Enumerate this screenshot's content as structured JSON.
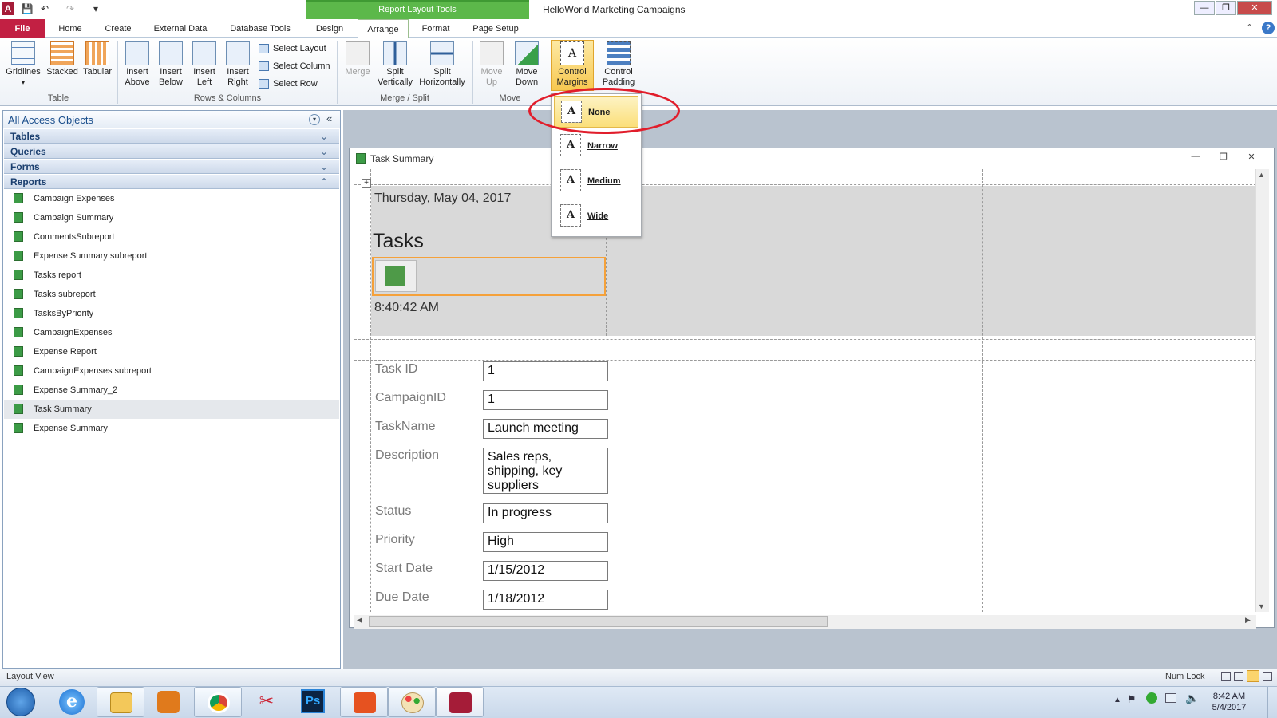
{
  "app": {
    "title": "HelloWorld Marketing Campaigns",
    "context_tab_group": "Report Layout Tools",
    "access_icon": "A"
  },
  "tabs": [
    {
      "label": "File"
    },
    {
      "label": "Home"
    },
    {
      "label": "Create"
    },
    {
      "label": "External Data"
    },
    {
      "label": "Database Tools"
    },
    {
      "label": "Design"
    },
    {
      "label": "Arrange"
    },
    {
      "label": "Format"
    },
    {
      "label": "Page Setup"
    }
  ],
  "ribbon": {
    "table_group": {
      "label": "Table",
      "gridlines": "Gridlines",
      "stacked": "Stacked",
      "tabular": "Tabular"
    },
    "rows_columns_group": {
      "label": "Rows & Columns",
      "insert_above": [
        "Insert",
        "Above"
      ],
      "insert_below": [
        "Insert",
        "Below"
      ],
      "insert_left": [
        "Insert",
        "Left"
      ],
      "insert_right": [
        "Insert",
        "Right"
      ],
      "select_layout": "Select Layout",
      "select_column": "Select Column",
      "select_row": "Select Row"
    },
    "merge_split_group": {
      "label": "Merge / Split",
      "merge": "Merge",
      "split_vertically": [
        "Split",
        "Vertically"
      ],
      "split_horizontally": [
        "Split",
        "Horizontally"
      ]
    },
    "move_group": {
      "label": "Move",
      "move_up": [
        "Move",
        "Up"
      ],
      "move_down": [
        "Move",
        "Down"
      ]
    },
    "position_group": {
      "control_margins": [
        "Control",
        "Margins"
      ],
      "control_padding": [
        "Control",
        "Padding"
      ]
    }
  },
  "margins_dropdown": {
    "items": [
      "None",
      "Narrow",
      "Medium",
      "Wide"
    ],
    "selected": "None"
  },
  "nav_pane": {
    "title": "All Access Objects",
    "groups": [
      "Tables",
      "Queries",
      "Forms",
      "Reports"
    ],
    "reports": [
      "Campaign Expenses",
      "Campaign Summary",
      "CommentsSubreport",
      "Expense Summary subreport",
      "Tasks report",
      "Tasks subreport",
      "TasksByPriority",
      "CampaignExpenses",
      "Expense Report",
      "CampaignExpenses subreport",
      "Expense Summary_2",
      "Task Summary",
      "Expense Summary"
    ],
    "selected_report": "Task Summary"
  },
  "document": {
    "title": "Task Summary",
    "date": "Thursday, May 04, 2017",
    "report_title": "Tasks",
    "time": "8:40:42 AM",
    "fields": [
      {
        "label": "Task ID",
        "value": "1"
      },
      {
        "label": "CampaignID",
        "value": "1"
      },
      {
        "label": "TaskName",
        "value": "Launch meeting"
      },
      {
        "label": "Description",
        "value": "Sales reps, shipping, key suppliers"
      },
      {
        "label": "Status",
        "value": "In progress"
      },
      {
        "label": "Priority",
        "value": "High"
      },
      {
        "label": "Start Date",
        "value": "1/15/2012"
      },
      {
        "label": "Due Date",
        "value": "1/18/2012"
      }
    ]
  },
  "status_bar": {
    "view": "Layout View",
    "num_lock": "Num Lock"
  },
  "taskbar": {
    "clock_time": "8:42 AM",
    "clock_date": "5/4/2017",
    "apps": [
      "windows-start-icon",
      "internet-explorer-icon",
      "file-explorer-icon",
      "media-player-icon",
      "chrome-icon",
      "snipping-tool-icon",
      "photoshop-icon",
      "office-icon",
      "paint-icon",
      "access-icon"
    ],
    "photoshop_label": "Ps"
  },
  "colors": {
    "file_tab": "#c22043",
    "context_tab": "#5cb84a",
    "selection": "#f7c850",
    "highlight_ring": "#e11d2b"
  }
}
